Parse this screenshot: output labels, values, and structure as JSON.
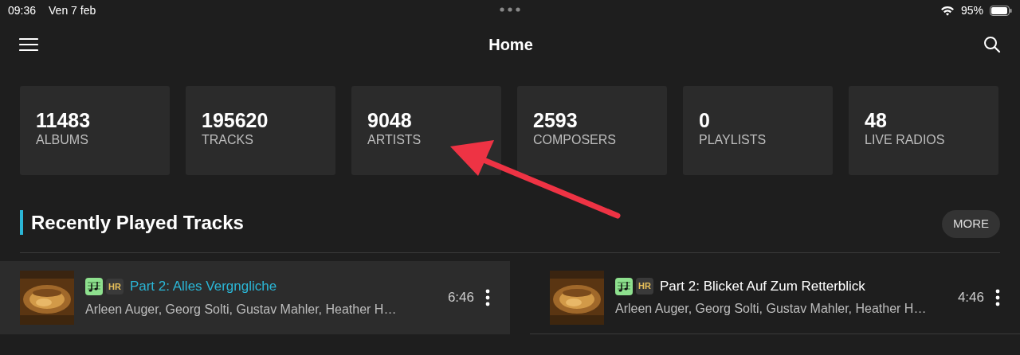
{
  "status_bar": {
    "time": "09:36",
    "date": "Ven 7 feb",
    "battery": "95%"
  },
  "header": {
    "title": "Home"
  },
  "stats": [
    {
      "value": "11483",
      "label": "ALBUMS"
    },
    {
      "value": "195620",
      "label": "TRACKS"
    },
    {
      "value": "9048",
      "label": "ARTISTS"
    },
    {
      "value": "2593",
      "label": "COMPOSERS"
    },
    {
      "value": "0",
      "label": "PLAYLISTS"
    },
    {
      "value": "48",
      "label": "LIVE RADIOS"
    }
  ],
  "section": {
    "title": "Recently Played Tracks",
    "more": "MORE"
  },
  "tracks": [
    {
      "badge": "HR",
      "title": "Part 2: Alles Vergngliche",
      "artists": "Arleen Auger, Georg Solti, Gustav Mahler, Heather H…",
      "duration": "6:46",
      "selected": true
    },
    {
      "badge": "HR",
      "title": "Part 2: Blicket Auf Zum Retterblick",
      "artists": "Arleen Auger, Georg Solti, Gustav Mahler, Heather H…",
      "duration": "4:46",
      "selected": false
    }
  ]
}
